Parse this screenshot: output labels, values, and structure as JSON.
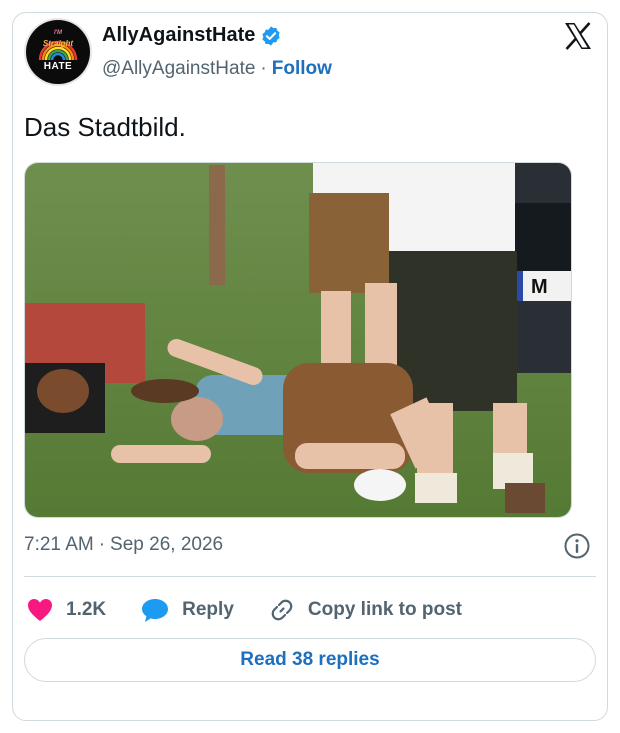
{
  "author": {
    "display_name": "AllyAgainstHate",
    "handle": "@AllyAgainstHate",
    "follow_label": "Follow",
    "avatar_text": {
      "top": "I'M",
      "middle": "Straight",
      "bottom": "HATE"
    }
  },
  "tweet": {
    "text": "Das Stadtbild.",
    "time": "7:21 AM",
    "date": "Sep 26, 2026",
    "photo": {
      "plate_text": "M"
    }
  },
  "actions": {
    "likes": "1.2K",
    "reply_label": "Reply",
    "copy_label": "Copy link to post"
  },
  "footer": {
    "read_replies_label": "Read 38 replies"
  },
  "colors": {
    "like": "#f91880",
    "reply": "#1d9bf0",
    "accent": "#1d6fbf",
    "verified": "#1d9bf0"
  },
  "icons": [
    "verified-badge-icon",
    "x-logo-icon",
    "info-icon",
    "heart-icon",
    "reply-bubble-icon",
    "link-icon"
  ]
}
